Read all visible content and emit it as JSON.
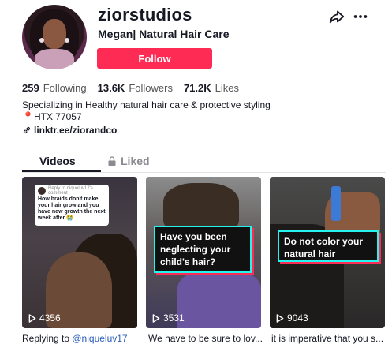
{
  "profile": {
    "username": "ziorstudios",
    "display_name": "Megan| Natural Hair Care",
    "follow_label": "Follow",
    "bio_line1": "Specializing in Healthy natural hair care & protective styling",
    "bio_line2": "📍HTX 77057",
    "link": "linktr.ee/ziorandco"
  },
  "stats": {
    "following_count": "259",
    "following_label": "Following",
    "followers_count": "13.6K",
    "followers_label": "Followers",
    "likes_count": "71.2K",
    "likes_label": "Likes"
  },
  "tabs": {
    "videos": "Videos",
    "liked": "Liked"
  },
  "videos": [
    {
      "views": "4356",
      "caption_prefix": "Replying to ",
      "caption_mention": "@niqueluv17",
      "reply_header": "Reply to niqueluv17's comment",
      "reply_text": "How braids don't make your hair grow and you have new growth the next week after 😭"
    },
    {
      "views": "3531",
      "caption": "We have to be sure to lov...",
      "overlay": "Have you been neglecting your child's hair?"
    },
    {
      "views": "9043",
      "caption": "it is imperative that you s...",
      "overlay": "Do not color your natural hair"
    }
  ],
  "colors": {
    "accent": "#fe2c55",
    "cyan": "#25f4ee",
    "mention": "#2b5db9"
  },
  "icons": {
    "share": "share-arrow-icon",
    "more": "more-dots-icon",
    "lock": "lock-icon",
    "link": "link-icon",
    "play": "play-icon"
  }
}
